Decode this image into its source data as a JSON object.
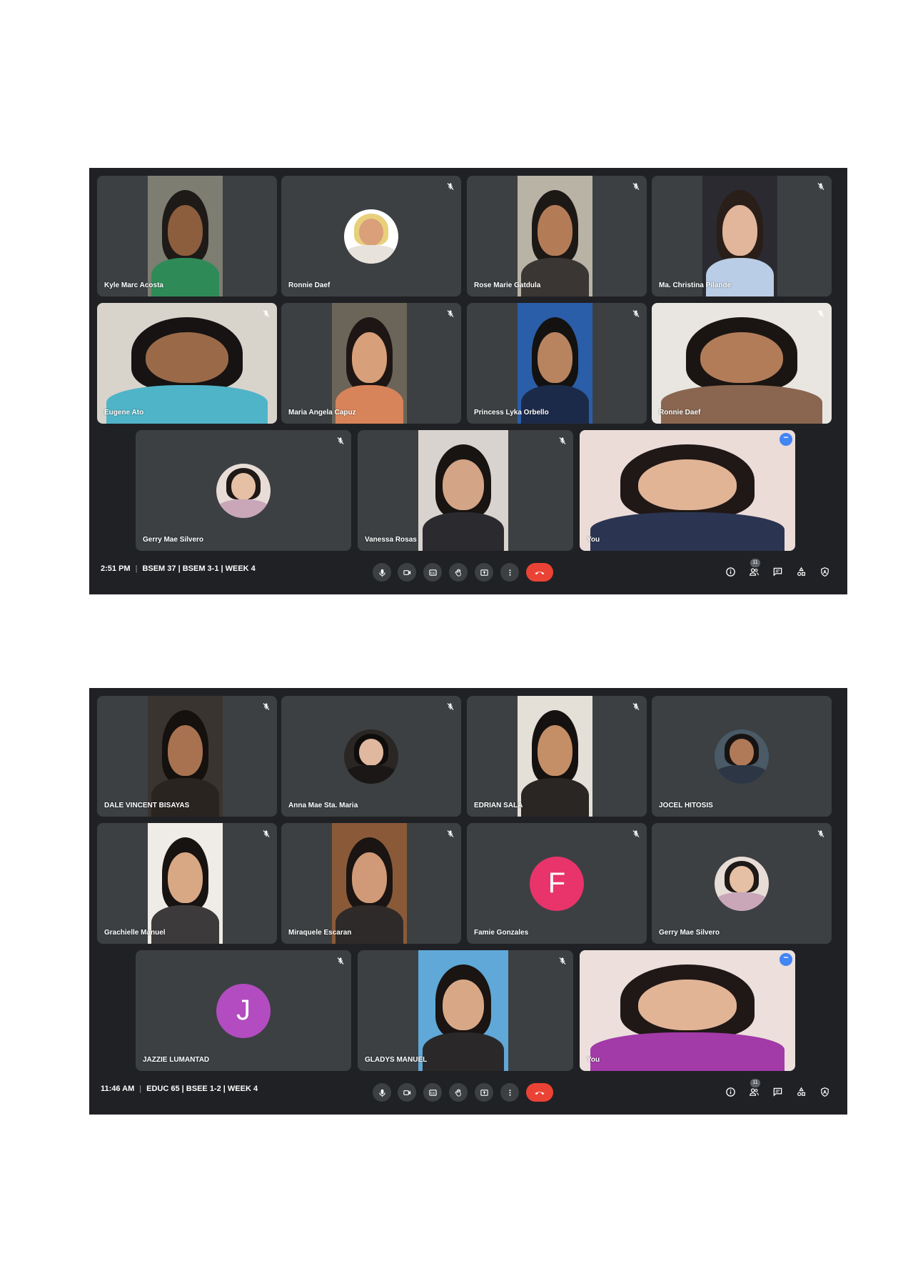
{
  "meetings": [
    {
      "info": {
        "time": "2:51 PM",
        "title": "BSEM 37 | BSEM 3-1 | WEEK 4",
        "people_count": "11"
      },
      "participants": [
        {
          "name": "Kyle Marc Acosta",
          "kind": "video",
          "muted": false,
          "bg": "#7d7d72",
          "skin": "#8d5e3e",
          "hair": "#1e1a17",
          "shirt": "#2e8b57"
        },
        {
          "name": "Ronnie Daef",
          "kind": "photo",
          "muted": true,
          "bg": "#ffffff",
          "skin": "#d9a07a",
          "hair": "#e8d07a",
          "shirt": "#e8e2dc"
        },
        {
          "name": "Rose Marie Gatdula",
          "kind": "video",
          "muted": true,
          "bg": "#b9b3a6",
          "skin": "#b47c56",
          "hair": "#1c1816",
          "shirt": "#3a3634"
        },
        {
          "name": "Ma. Christina Pilande",
          "kind": "video",
          "muted": true,
          "bg": "#2a2a30",
          "skin": "#e2b69a",
          "hair": "#2a1e18",
          "shirt": "#b9cde6"
        },
        {
          "name": "Eugene Ato",
          "kind": "video_full",
          "muted": true,
          "bg": "#d8d4cc",
          "skin": "#9a6a48",
          "hair": "#161312",
          "shirt": "#4fb4c8"
        },
        {
          "name": "Maria Angela Capuz",
          "kind": "video",
          "muted": true,
          "bg": "#6b6458",
          "skin": "#d8a07a",
          "hair": "#1e1614",
          "shirt": "#d8845a"
        },
        {
          "name": "Princess Lyka Orbello",
          "kind": "video",
          "muted": true,
          "bg": "#2a5ea8",
          "skin": "#b88460",
          "hair": "#141210",
          "shirt": "#1c2a4a"
        },
        {
          "name": "Ronnie Daef",
          "kind": "video_full",
          "muted": true,
          "bg": "#e9e6e2",
          "skin": "#b27c58",
          "hair": "#1a1512",
          "shirt": "#8a6650"
        },
        {
          "name": "Gerry Mae Silvero",
          "kind": "photo",
          "muted": true,
          "bg": "#e8dcd6",
          "skin": "#e6c0a4",
          "hair": "#1e1816",
          "shirt": "#c9a6b8"
        },
        {
          "name": "Vanessa Rosas",
          "kind": "video",
          "muted": true,
          "bg": "#d9d3cf",
          "skin": "#d4a486",
          "hair": "#181412",
          "shirt": "#2b2a2e"
        },
        {
          "name": "You",
          "kind": "self",
          "muted": false,
          "bg": "#ecdcd8",
          "skin": "#e2b496",
          "hair": "#201816",
          "shirt": "#2b3552"
        }
      ]
    },
    {
      "info": {
        "time": "11:46 AM",
        "title": "EDUC 65 | BSEE 1-2 | WEEK 4",
        "people_count": "11"
      },
      "participants": [
        {
          "name": "DALE VINCENT BISAYAS",
          "kind": "video",
          "muted": true,
          "bg": "#3a3430",
          "skin": "#a87250",
          "hair": "#14110f",
          "shirt": "#2a2420"
        },
        {
          "name": "Anna Mae Sta. Maria",
          "kind": "photo",
          "muted": true,
          "bg": "#2a2624",
          "skin": "#e0b8a0",
          "hair": "#0f0d0c",
          "shirt": "#1a1716"
        },
        {
          "name": "EDRIAN SALA",
          "kind": "video",
          "muted": true,
          "bg": "#e4e0d8",
          "skin": "#c48e66",
          "hair": "#141110",
          "shirt": "#2a2624"
        },
        {
          "name": "JOCEL HITOSIS",
          "kind": "photo",
          "muted": false,
          "bg": "#4a5a66",
          "skin": "#b07a58",
          "hair": "#161312",
          "shirt": "#2c3644"
        },
        {
          "name": "Grachielle Manuel",
          "kind": "video",
          "muted": true,
          "bg": "#efece8",
          "skin": "#d8a884",
          "hair": "#171311",
          "shirt": "#3c3a3a"
        },
        {
          "name": "Miraquele Escaran",
          "kind": "video",
          "muted": true,
          "bg": "#8a5a38",
          "skin": "#d09a78",
          "hair": "#1a1412",
          "shirt": "#2e2a2a"
        },
        {
          "name": "Famie Gonzales",
          "kind": "letter",
          "muted": true,
          "letter": "F",
          "color": "#e8336b"
        },
        {
          "name": "Gerry Mae Silvero",
          "kind": "photo",
          "muted": true,
          "bg": "#e8dcd6",
          "skin": "#e6c0a4",
          "hair": "#1e1816",
          "shirt": "#c9a6b8"
        },
        {
          "name": "JAZZIE LUMANTAD",
          "kind": "letter",
          "muted": true,
          "letter": "J",
          "color": "#b34cc0"
        },
        {
          "name": "GLADYS MANUEL",
          "kind": "video",
          "muted": true,
          "bg": "#5fa8d8",
          "skin": "#d8a886",
          "hair": "#1a1412",
          "shirt": "#2a2828"
        },
        {
          "name": "You",
          "kind": "self",
          "muted": false,
          "bg": "#ecdfdc",
          "skin": "#e2b496",
          "hair": "#201816",
          "shirt": "#a23aa8"
        }
      ]
    }
  ],
  "controls": {
    "buttons": [
      "microphone-icon",
      "camera-icon",
      "captions-icon",
      "raise-hand-icon",
      "present-screen-icon",
      "more-options-icon",
      "end-call-icon"
    ],
    "right_icons": [
      "meeting-details-icon",
      "people-icon",
      "chat-icon",
      "activities-icon",
      "host-controls-icon"
    ]
  },
  "colors": {
    "meet_bg": "#202124",
    "tile_bg": "#3c4043",
    "end_call": "#ea4335",
    "self_border": "#8ab4f8"
  }
}
